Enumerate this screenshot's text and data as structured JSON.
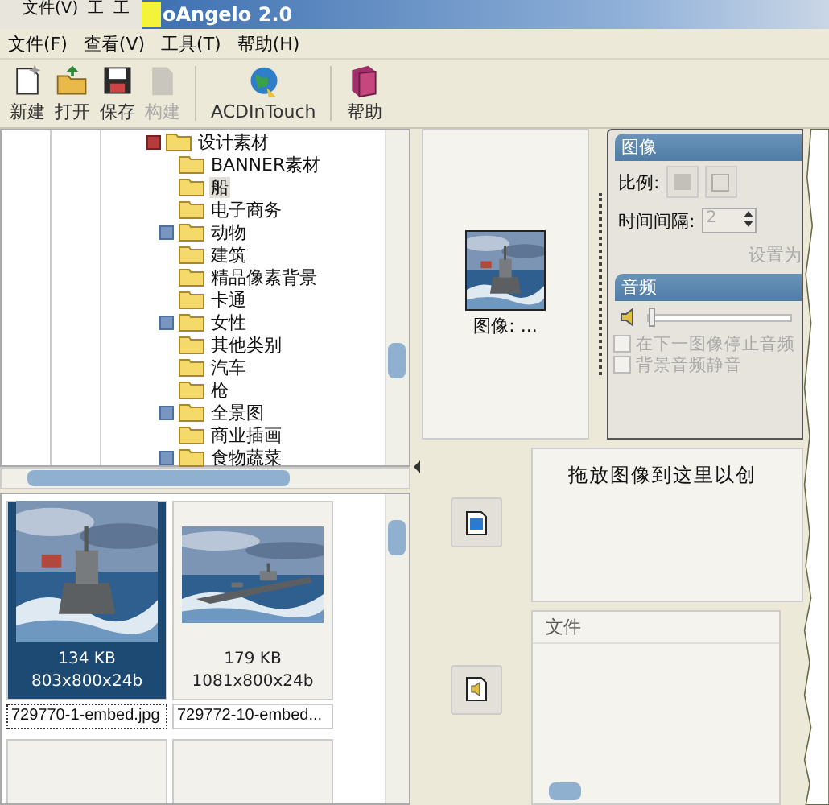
{
  "background_window": {
    "menu": [
      "文件(V)",
      "工",
      "工"
    ]
  },
  "window": {
    "title": "oAngelo 2.0"
  },
  "menu": [
    "文件(F)",
    "查看(V)",
    "工具(T)",
    "帮助(H)"
  ],
  "toolbar": [
    {
      "label": "新建",
      "kind": "new",
      "disabled": false
    },
    {
      "label": "打开",
      "kind": "open",
      "disabled": false
    },
    {
      "label": "保存",
      "kind": "save",
      "disabled": false
    },
    {
      "label": "构建",
      "kind": "build",
      "disabled": true
    },
    {
      "label": "ACDInTouch",
      "kind": "globe",
      "disabled": false
    },
    {
      "label": "帮助",
      "kind": "book",
      "disabled": false
    }
  ],
  "folder_tree": {
    "items": [
      {
        "label": "设计素材",
        "expanded": true,
        "selected": false,
        "children": [
          {
            "label": "BANNER素材",
            "expandable": false,
            "selected": false
          },
          {
            "label": "船",
            "expandable": false,
            "selected": true
          },
          {
            "label": "电子商务",
            "expandable": false,
            "selected": false
          },
          {
            "label": "动物",
            "expandable": true,
            "selected": false
          },
          {
            "label": "建筑",
            "expandable": false,
            "selected": false
          },
          {
            "label": "精品像素背景",
            "expandable": false,
            "selected": false
          },
          {
            "label": "卡通",
            "expandable": false,
            "selected": false
          },
          {
            "label": "女性",
            "expandable": true,
            "selected": false
          },
          {
            "label": "其他类别",
            "expandable": false,
            "selected": false
          },
          {
            "label": "汽车",
            "expandable": false,
            "selected": false
          },
          {
            "label": "枪",
            "expandable": false,
            "selected": false
          },
          {
            "label": "全景图",
            "expandable": true,
            "selected": false
          },
          {
            "label": "商业插画",
            "expandable": false,
            "selected": false
          },
          {
            "label": "食物蔬菜",
            "expandable": true,
            "selected": false
          }
        ]
      }
    ]
  },
  "thumbnails": [
    {
      "kind": "picture",
      "size": "134 KB",
      "dimensions": "803x800x24b",
      "filename": "729770-1-embed.jpg",
      "selected": true
    },
    {
      "kind": "picture",
      "size": "179 KB",
      "dimensions": "1081x800x24b",
      "filename": "729772-10-embed...",
      "selected": false
    }
  ],
  "preview": {
    "kind": "picture",
    "caption": "图像: ..."
  },
  "image_panel": {
    "title": "图像",
    "scale_label": "比例:",
    "interval_label": "时间间隔:",
    "interval_value": "2",
    "interval_disabled": true,
    "default_button": "设置为"
  },
  "audio_panel": {
    "title": "音频",
    "level": 0,
    "options": [
      {
        "label": "在下一图像停止音频",
        "checked": false,
        "disabled": true
      },
      {
        "label": "背景音频静音",
        "checked": false,
        "disabled": true
      }
    ]
  },
  "drop_area": {
    "hint": "拖放图像到这里以创"
  },
  "file_list": {
    "column": "文件"
  }
}
